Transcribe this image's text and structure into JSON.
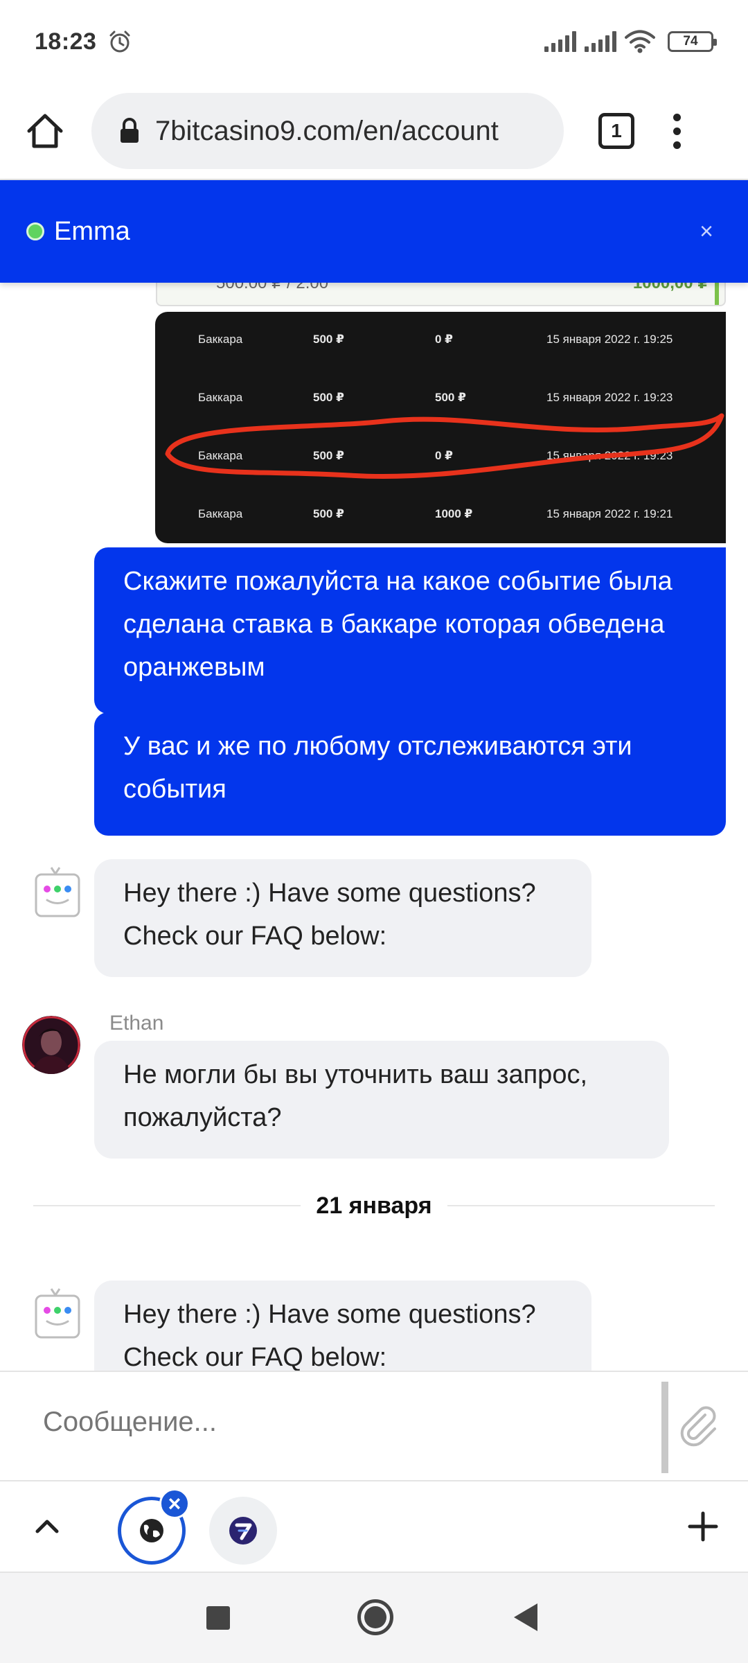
{
  "status_bar": {
    "time": "18:23",
    "battery": "74",
    "icons": [
      "alarm-icon",
      "signal-icon",
      "signal-icon",
      "wifi-icon",
      "battery-icon"
    ]
  },
  "browser": {
    "url": "7bitcasino9.com/en/account",
    "tab_count": "1",
    "icons": [
      "home-icon",
      "lock-icon",
      "tabs-icon",
      "more-vert-icon"
    ]
  },
  "chat_header": {
    "name": "Emma",
    "close_label": "×",
    "online_color": "#5fd35f",
    "accent_color": "#0336ec"
  },
  "previous_image": {
    "left_text": "500.00 ₽ / 2.00",
    "right_text": "1000,00 ₽"
  },
  "screenshot_table": {
    "rows": [
      {
        "game": "Баккара",
        "bet": "500 ₽",
        "win": "0 ₽",
        "date": "15 января 2022 г. 19:25"
      },
      {
        "game": "Баккара",
        "bet": "500 ₽",
        "win": "500 ₽",
        "date": "15 января 2022 г. 19:23"
      },
      {
        "game": "Баккара",
        "bet": "500 ₽",
        "win": "0 ₽",
        "date": "15 января 2022 г. 19:23"
      },
      {
        "game": "Баккара",
        "bet": "500 ₽",
        "win": "1000 ₽",
        "date": "15 января 2022 г. 19:21"
      }
    ],
    "highlight_color": "#e8321c"
  },
  "messages": {
    "out1": "Скажите пожалуйста на какое событие была сделана ставка в баккаре которая обведена оранжевым",
    "out2": "У вас и же по любому отслеживаются эти события",
    "bot1": "Hey there :) Have some questions? Check our FAQ below:",
    "agent_name": "Ethan",
    "agent1": "Не могли бы вы уточнить ваш запрос, пожалуйста?",
    "date_separator": "21 января",
    "bot2": "Hey there :) Have some questions? Check our FAQ below:"
  },
  "composer": {
    "placeholder": "Сообщение..."
  },
  "bottom_bar": {
    "tab_close_label": "×"
  }
}
